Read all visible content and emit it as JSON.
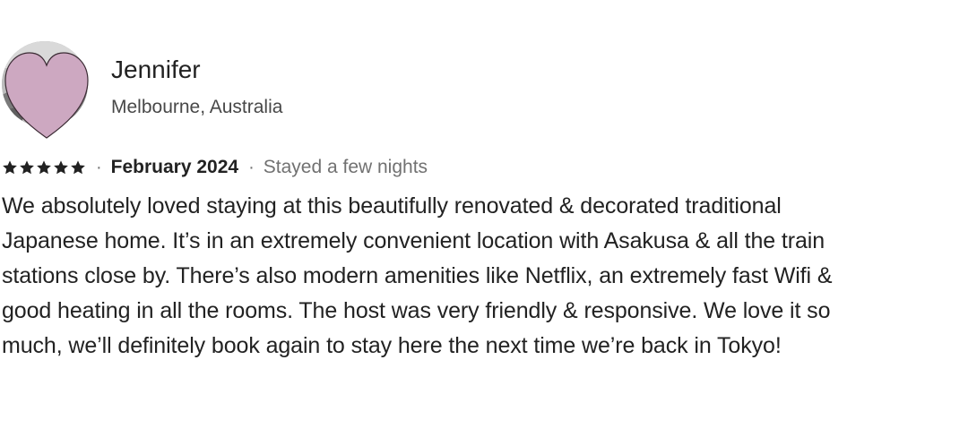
{
  "reviewer": {
    "name": "Jennifer",
    "location": "Melbourne, Australia",
    "avatar_icon": "heart-icon",
    "heart_color": "#cda8c1"
  },
  "review": {
    "rating": 5,
    "rating_max": 5,
    "separator": "·",
    "date": "February 2024",
    "stay_length": "Stayed a few nights",
    "text_lines": [
      "We absolutely loved staying at this beautifully renovated & decorated traditional",
      "Japanese home. It’s in an extremely convenient location with Asakusa & all the train",
      "stations close by. There’s also modern amenities like Netflix, an extremely fast Wifi &",
      "good heating in all the rooms. The host was very friendly & responsive. We love it so",
      "much, we’ll definitely book again to stay here the next time we’re back in Tokyo!"
    ]
  },
  "colors": {
    "text_primary": "#222222",
    "text_secondary": "#717171",
    "star": "#222222"
  }
}
